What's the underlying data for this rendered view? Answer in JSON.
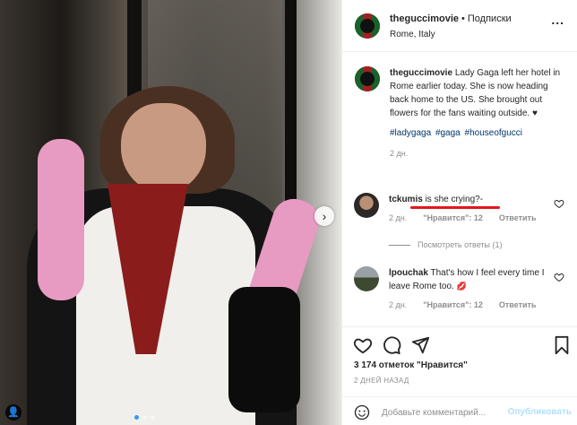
{
  "post": {
    "author": "theguccimovie",
    "separator": "•",
    "follow_label": "Подписки",
    "location": "Rome, Italy",
    "more_label": "...",
    "caption_text": "Lady Gaga left her hotel in Rome earlier today. She is now heading back home to the US. She brought out flowers for the fans waiting outside. ♥",
    "hashtags": [
      "#ladygaga",
      "#gaga",
      "#houseofgucci"
    ],
    "caption_time": "2 дн."
  },
  "comments": [
    {
      "user": "tckumis",
      "text": "is she crying?-",
      "time": "2 дн.",
      "likes": "\"Нравится\": 12",
      "reply": "Ответить"
    },
    {
      "user": "lpouchak",
      "text": "That's how I feel every time I leave Rome too.",
      "emoji": "💋",
      "time": "2 дн.",
      "likes": "\"Нравится\": 12",
      "reply": "Ответить"
    }
  ],
  "view_replies": "Посмотреть ответы (1)",
  "likes_count": "3 174 отметок \"Нравится\"",
  "date": "2 ДНЕЙ НАЗАД",
  "comment_input": {
    "placeholder": "Добавьте комментарий...",
    "value": ""
  },
  "publish_label": "Опубликовать",
  "icons": [
    "heart-icon",
    "comment-icon",
    "share-icon",
    "bookmark-icon",
    "emoji-icon",
    "chevron-right-icon",
    "user-tag-icon"
  ],
  "colors": {
    "link": "#00376b",
    "accent_blue": "#3897f0",
    "publish_disabled": "#b2dffc",
    "annotation_red": "#e4161b"
  }
}
